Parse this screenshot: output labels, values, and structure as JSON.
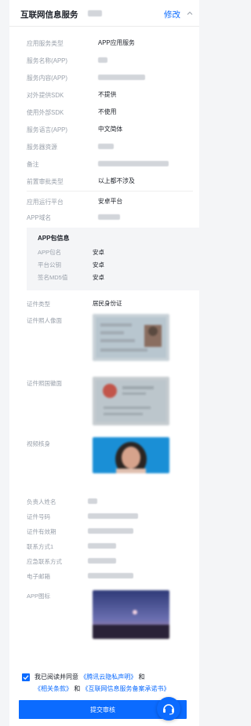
{
  "header": {
    "title": "互联网信息服务",
    "edit_label": "修改"
  },
  "basic_info": {
    "rows": [
      {
        "label": "应用服务类型",
        "value": "APP应用服务"
      },
      {
        "label": "服务名称(APP)",
        "value": ""
      },
      {
        "label": "服务内容(APP)",
        "value": ""
      },
      {
        "label": "对外提供SDK",
        "value": "不提供"
      },
      {
        "label": "使用外部SDK",
        "value": "不使用"
      },
      {
        "label": "服务语言(APP)",
        "value": "中文简体"
      },
      {
        "label": "服务器资源",
        "value": ""
      },
      {
        "label": "备注",
        "value": ""
      },
      {
        "label": "前置审批类型",
        "value": "以上都不涉及"
      }
    ]
  },
  "platform_info": {
    "rows": [
      {
        "label": "应用运行平台",
        "value": "安卓平台"
      },
      {
        "label": "APP域名",
        "value": ""
      }
    ]
  },
  "package_info": {
    "title": "APP包信息",
    "rows": [
      {
        "label": "APP包名",
        "value": "安卓"
      },
      {
        "label": "平台公钥",
        "value": "安卓"
      },
      {
        "label": "签名MD5值",
        "value": "安卓"
      }
    ]
  },
  "certificate": {
    "type_label": "证件类型",
    "type_value": "居民身份证",
    "front_label": "证件照人像面",
    "back_label": "证件照国徽面",
    "video_label": "视频核身"
  },
  "contact_info": {
    "rows": [
      {
        "label": "负责人姓名",
        "value": ""
      },
      {
        "label": "证件号码",
        "value": ""
      },
      {
        "label": "证件有效期",
        "value": ""
      },
      {
        "label": "联系方式1",
        "value": ""
      },
      {
        "label": "应急联系方式",
        "value": ""
      },
      {
        "label": "电子邮箱",
        "value": ""
      }
    ],
    "app_icon_label": "APP图标"
  },
  "agreement": {
    "prefix": "我已阅读并同意",
    "link_privacy": "《腾讯云隐私声明》",
    "and1": "和",
    "link_terms": "《相关条款》",
    "and2": "和",
    "link_commitment": "《互联网信息服务备案承诺书》"
  },
  "submit_label": "提交审核",
  "colors": {
    "primary": "#0b6bff",
    "label_gray": "#9aa1ab",
    "panel_bg": "#f4f5f7"
  }
}
